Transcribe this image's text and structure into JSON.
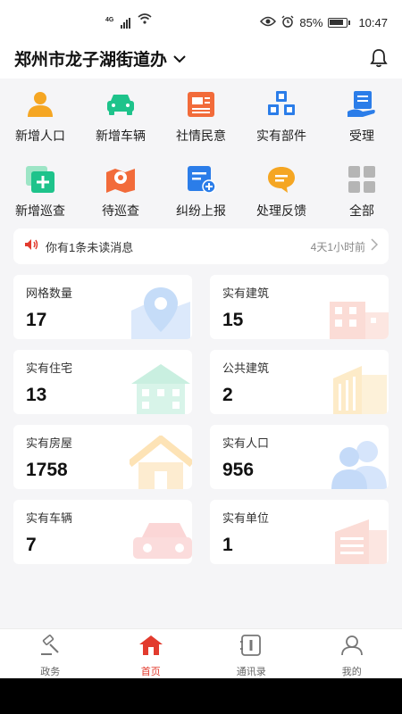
{
  "status_bar": {
    "network_label": "4G",
    "battery_percent": "85%",
    "time": "10:47"
  },
  "header": {
    "title": "郑州市龙子湖街道办",
    "dropdown_icon": "chevron-down-icon",
    "bell_icon": "bell-icon"
  },
  "grid": {
    "row1": [
      {
        "label": "新增人口",
        "icon": "person-icon",
        "color": "#f5a623"
      },
      {
        "label": "新增车辆",
        "icon": "car-icon",
        "color": "#1ec38b"
      },
      {
        "label": "社情民意",
        "icon": "newspaper-icon",
        "color": "#f26b3a"
      },
      {
        "label": "实有部件",
        "icon": "cubes-icon",
        "color": "#2b7de9"
      },
      {
        "label": "受理",
        "icon": "hand-document-icon",
        "color": "#2b7de9"
      }
    ],
    "row2": [
      {
        "label": "新增巡查",
        "icon": "add-patrol-icon",
        "color": "#1ec38b"
      },
      {
        "label": "待巡查",
        "icon": "map-pin-icon",
        "color": "#f26b3a"
      },
      {
        "label": "纠纷上报",
        "icon": "report-add-icon",
        "color": "#2b7de9"
      },
      {
        "label": "处理反馈",
        "icon": "chat-bubble-icon",
        "color": "#f5a623"
      },
      {
        "label": "全部",
        "icon": "grid-all-icon",
        "color": "#b5b5b5"
      }
    ]
  },
  "message": {
    "text": "你有1条未读消息",
    "time": "4天1小时前",
    "icon": "speaker-icon"
  },
  "stats": [
    {
      "label": "网格数量",
      "value": "17",
      "deco": "map-pin-icon"
    },
    {
      "label": "实有建筑",
      "value": "15",
      "deco": "building-icon"
    },
    {
      "label": "实有住宅",
      "value": "13",
      "deco": "residence-icon"
    },
    {
      "label": "公共建筑",
      "value": "2",
      "deco": "public-building-icon"
    },
    {
      "label": "实有房屋",
      "value": "1758",
      "deco": "house-icon"
    },
    {
      "label": "实有人口",
      "value": "956",
      "deco": "people-icon"
    },
    {
      "label": "实有车辆",
      "value": "7",
      "deco": "car-icon"
    },
    {
      "label": "实有单位",
      "value": "1",
      "deco": "office-icon"
    }
  ],
  "bottom_nav": [
    {
      "label": "政务",
      "icon": "gavel-icon",
      "active": false
    },
    {
      "label": "首页",
      "icon": "home-icon",
      "active": true
    },
    {
      "label": "通讯录",
      "icon": "contacts-icon",
      "active": false
    },
    {
      "label": "我的",
      "icon": "user-icon",
      "active": false
    }
  ],
  "colors": {
    "accent": "#e23b2e",
    "background": "#f5f5f7"
  }
}
